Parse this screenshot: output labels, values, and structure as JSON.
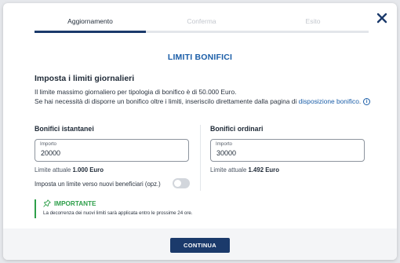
{
  "stepper": {
    "steps": [
      {
        "label": "Aggiornamento",
        "state": "active"
      },
      {
        "label": "Conferma",
        "state": "inactive"
      },
      {
        "label": "Esito",
        "state": "inactive"
      }
    ]
  },
  "close": {
    "icon": "close-icon"
  },
  "title": "LIMITI BONIFICI",
  "section": {
    "title": "Imposta i limiti giornalieri",
    "line1": "Il limite massimo giornaliero per tipologia di bonifico è di 50.000 Euro.",
    "line2_prefix": "Se hai necessità di disporre un bonifico oltre i limiti, inseriscilo direttamente dalla pagina di ",
    "line2_link": "disposizione bonifico",
    "line2_suffix": "."
  },
  "instant": {
    "title": "Bonifici istantanei",
    "field_label": "Importo",
    "value": "20000",
    "current_label": "Limite attuale",
    "current_value": "1.000 Euro",
    "toggle_label": "Imposta un limite verso nuovi beneficiari (opz.)",
    "toggle_on": false
  },
  "ordinary": {
    "title": "Bonifici ordinari",
    "field_label": "Importo",
    "value": "30000",
    "current_label": "Limite attuale",
    "current_value": "1.492 Euro"
  },
  "important": {
    "title": "IMPORTANTE",
    "text": "La decorrenza dei nuovi limiti sarà applicata entro le prossime 24 ore."
  },
  "footer": {
    "button": "CONTINUA"
  },
  "colors": {
    "primary": "#1b3a6b",
    "link": "#1b5ea8",
    "success": "#2e9f4a"
  }
}
